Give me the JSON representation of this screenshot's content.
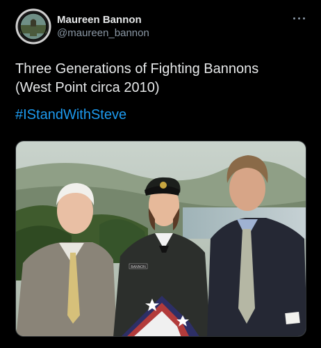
{
  "author": {
    "display_name": "Maureen Bannon",
    "handle": "@maureen_bannon",
    "avatar_icon": "army-seal-avatar"
  },
  "tweet": {
    "text_line1": "Three Generations of Fighting Bannons",
    "text_line2": "(West Point circa 2010)",
    "hashtag": "#IStandWithSteve"
  },
  "photo": {
    "name_tag": "BANNON"
  },
  "colors": {
    "background": "#000000",
    "text": "#e7e9ea",
    "secondary": "#8b98a5",
    "link": "#1d9bf0"
  }
}
